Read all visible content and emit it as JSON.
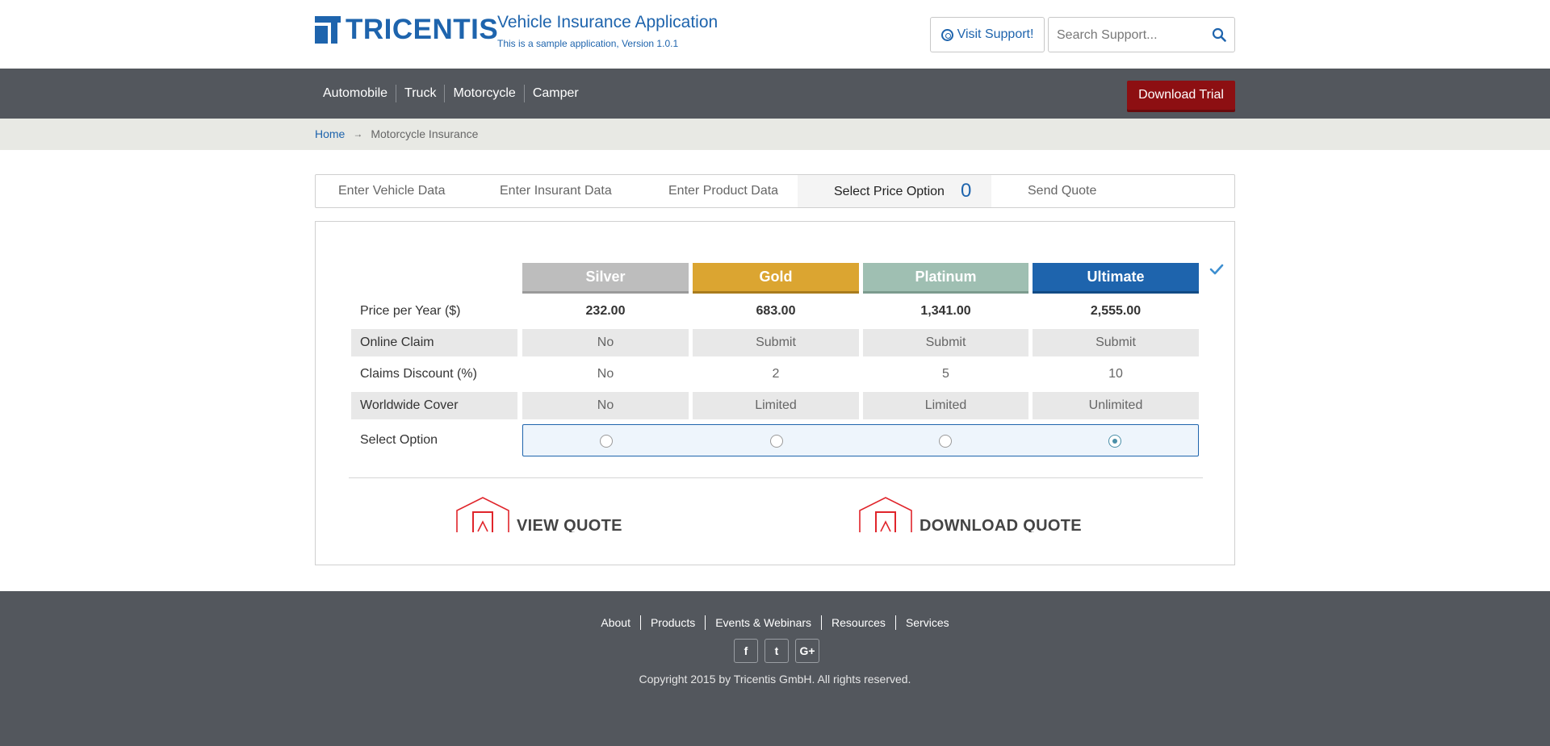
{
  "header": {
    "logo_text": "TRICENTIS",
    "app_title": "Vehicle Insurance Application",
    "app_subtitle": "This is a sample application, Version 1.0.1",
    "support_button": "Visit Support!",
    "search_placeholder": "Search Support..."
  },
  "nav": {
    "items": [
      "Automobile",
      "Truck",
      "Motorcycle",
      "Camper"
    ],
    "download_trial": "Download Trial"
  },
  "breadcrumb": {
    "home": "Home",
    "separator": "→",
    "current": "Motorcycle Insurance"
  },
  "wizard": {
    "tabs": [
      "Enter Vehicle Data",
      "Enter Insurant Data",
      "Enter Product Data",
      "Select Price Option",
      "Send Quote"
    ],
    "active_tab": "Select Price Option",
    "active_count": "0"
  },
  "price_table": {
    "plans": [
      {
        "name": "Silver",
        "color": "#bdbdbd"
      },
      {
        "name": "Gold",
        "color": "#dba531"
      },
      {
        "name": "Platinum",
        "color": "#9fbfb2"
      },
      {
        "name": "Ultimate",
        "color": "#1e64ad"
      }
    ],
    "rows": [
      {
        "label": "Price per Year ($)",
        "values": [
          "232.00",
          "683.00",
          "1,341.00",
          "2,555.00"
        ]
      },
      {
        "label": "Online Claim",
        "values": [
          "No",
          "Submit",
          "Submit",
          "Submit"
        ]
      },
      {
        "label": "Claims Discount (%)",
        "values": [
          "No",
          "2",
          "5",
          "10"
        ]
      },
      {
        "label": "Worldwide Cover",
        "values": [
          "No",
          "Limited",
          "Limited",
          "Unlimited"
        ]
      }
    ],
    "select_label": "Select Option",
    "selected_plan": "Ultimate"
  },
  "actions": {
    "view_quote": "VIEW QUOTE",
    "download_quote": "DOWNLOAD QUOTE"
  },
  "footer": {
    "links": [
      "About",
      "Products",
      "Events & Webinars",
      "Resources",
      "Services"
    ],
    "social": [
      "f",
      "t",
      "G+"
    ],
    "copyright": "Copyright 2015 by Tricentis GmbH. All rights reserved."
  },
  "colors": {
    "brand_blue": "#1e64ad",
    "nav_bg": "#53575d",
    "download_red": "#8d0f12",
    "pdf_red": "#e0252b"
  }
}
